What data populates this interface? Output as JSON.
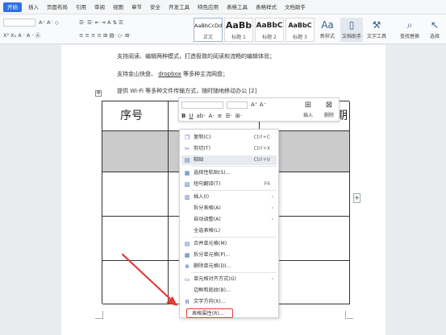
{
  "tabs": [
    "开始",
    "插入",
    "页面布局",
    "引用",
    "审阅",
    "视图",
    "章节",
    "安全",
    "开发工具",
    "特色应用",
    "表格工具",
    "表格样式",
    "文档助手"
  ],
  "ribbon": {
    "styles": [
      {
        "sample": "AaBbCcDd",
        "name": "正文"
      },
      {
        "sample": "AaBb",
        "name": "标题 1"
      },
      {
        "sample": "AaBbC",
        "name": "标题 2"
      },
      {
        "sample": "AaBbC",
        "name": "标题 3"
      }
    ],
    "new_style": "新样式",
    "text_layout": "文档助手",
    "text_tools": "文字工具",
    "find_replace": "查找替换",
    "select": "选择"
  },
  "document": {
    "line1": "支持阅读、编辑两种模式，打造极致的阅读和流畅的编辑体验；",
    "line2_a": "支持金山快盘、",
    "line2_link": "dropbox",
    "line2_b": "等多种主流网盘；",
    "line3": "提供 Wi-Fi 等多种文件传输方式，随时随地移动办公 [2]",
    "table_header_left": "序号",
    "table_header_right": "期"
  },
  "mini_toolbar": {
    "insert": "插入",
    "delete": "删除"
  },
  "context_menu": [
    {
      "icon": "copy-icon",
      "glyph": "❐",
      "label": "复制(C)",
      "shortcut": "Ctrl+C"
    },
    {
      "icon": "cut-icon",
      "glyph": "✂",
      "label": "剪切(T)",
      "shortcut": "Ctrl+X"
    },
    {
      "icon": "paste-icon",
      "glyph": "▤",
      "label": "粘贴",
      "shortcut": "Ctrl+V"
    },
    {
      "icon": "paste-special-icon",
      "glyph": "▦",
      "label": "选择性粘贴(S)..."
    },
    {
      "icon": "translate-icon",
      "glyph": "▧",
      "label": "短句翻译(T)",
      "shortcut": "F6"
    },
    {
      "icon": "insert-icon",
      "glyph": "▥",
      "label": "插入(I)",
      "submenu": true
    },
    {
      "label": "拆分表格(A)",
      "submenu": true
    },
    {
      "label": "自动调整(A)",
      "submenu": true
    },
    {
      "label": "全选表格(L)"
    },
    {
      "icon": "merge-cells-icon",
      "glyph": "▤",
      "label": "合并单元格(M)"
    },
    {
      "icon": "split-cells-icon",
      "glyph": "▦",
      "label": "拆分单元格(P)..."
    },
    {
      "icon": "delete-cells-icon",
      "glyph": "⊗",
      "label": "删除单元格(D)..."
    },
    {
      "icon": "cell-align-icon",
      "glyph": "▭",
      "label": "单元格对齐方式(G)",
      "submenu": true
    },
    {
      "label": "边框和底纹(B)..."
    },
    {
      "icon": "text-direction-icon",
      "glyph": "Ⅲ",
      "label": "文字方向(X)..."
    },
    {
      "label": "表格属性(R)...",
      "highlight": true
    }
  ],
  "colors": {
    "accent": "#2f6fe4",
    "highlight_box": "#e53935",
    "arrow": "#e53935",
    "header_cell_gray": "#cbcbcb"
  }
}
